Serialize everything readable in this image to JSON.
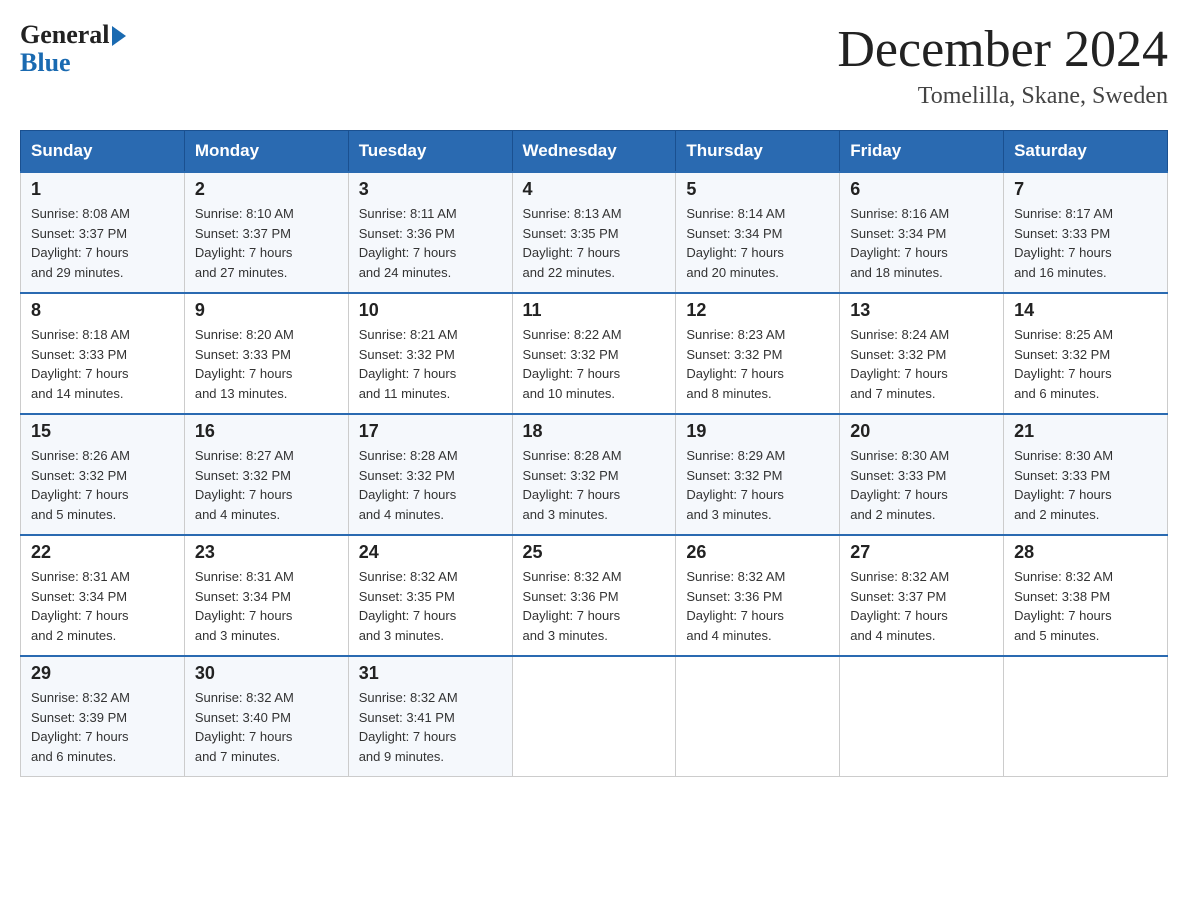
{
  "logo": {
    "general": "General",
    "blue": "Blue"
  },
  "title": "December 2024",
  "location": "Tomelilla, Skane, Sweden",
  "weekdays": [
    "Sunday",
    "Monday",
    "Tuesday",
    "Wednesday",
    "Thursday",
    "Friday",
    "Saturday"
  ],
  "weeks": [
    [
      {
        "day": "1",
        "sunrise": "8:08 AM",
        "sunset": "3:37 PM",
        "daylight": "7 hours and 29 minutes."
      },
      {
        "day": "2",
        "sunrise": "8:10 AM",
        "sunset": "3:37 PM",
        "daylight": "7 hours and 27 minutes."
      },
      {
        "day": "3",
        "sunrise": "8:11 AM",
        "sunset": "3:36 PM",
        "daylight": "7 hours and 24 minutes."
      },
      {
        "day": "4",
        "sunrise": "8:13 AM",
        "sunset": "3:35 PM",
        "daylight": "7 hours and 22 minutes."
      },
      {
        "day": "5",
        "sunrise": "8:14 AM",
        "sunset": "3:34 PM",
        "daylight": "7 hours and 20 minutes."
      },
      {
        "day": "6",
        "sunrise": "8:16 AM",
        "sunset": "3:34 PM",
        "daylight": "7 hours and 18 minutes."
      },
      {
        "day": "7",
        "sunrise": "8:17 AM",
        "sunset": "3:33 PM",
        "daylight": "7 hours and 16 minutes."
      }
    ],
    [
      {
        "day": "8",
        "sunrise": "8:18 AM",
        "sunset": "3:33 PM",
        "daylight": "7 hours and 14 minutes."
      },
      {
        "day": "9",
        "sunrise": "8:20 AM",
        "sunset": "3:33 PM",
        "daylight": "7 hours and 13 minutes."
      },
      {
        "day": "10",
        "sunrise": "8:21 AM",
        "sunset": "3:32 PM",
        "daylight": "7 hours and 11 minutes."
      },
      {
        "day": "11",
        "sunrise": "8:22 AM",
        "sunset": "3:32 PM",
        "daylight": "7 hours and 10 minutes."
      },
      {
        "day": "12",
        "sunrise": "8:23 AM",
        "sunset": "3:32 PM",
        "daylight": "7 hours and 8 minutes."
      },
      {
        "day": "13",
        "sunrise": "8:24 AM",
        "sunset": "3:32 PM",
        "daylight": "7 hours and 7 minutes."
      },
      {
        "day": "14",
        "sunrise": "8:25 AM",
        "sunset": "3:32 PM",
        "daylight": "7 hours and 6 minutes."
      }
    ],
    [
      {
        "day": "15",
        "sunrise": "8:26 AM",
        "sunset": "3:32 PM",
        "daylight": "7 hours and 5 minutes."
      },
      {
        "day": "16",
        "sunrise": "8:27 AM",
        "sunset": "3:32 PM",
        "daylight": "7 hours and 4 minutes."
      },
      {
        "day": "17",
        "sunrise": "8:28 AM",
        "sunset": "3:32 PM",
        "daylight": "7 hours and 4 minutes."
      },
      {
        "day": "18",
        "sunrise": "8:28 AM",
        "sunset": "3:32 PM",
        "daylight": "7 hours and 3 minutes."
      },
      {
        "day": "19",
        "sunrise": "8:29 AM",
        "sunset": "3:32 PM",
        "daylight": "7 hours and 3 minutes."
      },
      {
        "day": "20",
        "sunrise": "8:30 AM",
        "sunset": "3:33 PM",
        "daylight": "7 hours and 2 minutes."
      },
      {
        "day": "21",
        "sunrise": "8:30 AM",
        "sunset": "3:33 PM",
        "daylight": "7 hours and 2 minutes."
      }
    ],
    [
      {
        "day": "22",
        "sunrise": "8:31 AM",
        "sunset": "3:34 PM",
        "daylight": "7 hours and 2 minutes."
      },
      {
        "day": "23",
        "sunrise": "8:31 AM",
        "sunset": "3:34 PM",
        "daylight": "7 hours and 3 minutes."
      },
      {
        "day": "24",
        "sunrise": "8:32 AM",
        "sunset": "3:35 PM",
        "daylight": "7 hours and 3 minutes."
      },
      {
        "day": "25",
        "sunrise": "8:32 AM",
        "sunset": "3:36 PM",
        "daylight": "7 hours and 3 minutes."
      },
      {
        "day": "26",
        "sunrise": "8:32 AM",
        "sunset": "3:36 PM",
        "daylight": "7 hours and 4 minutes."
      },
      {
        "day": "27",
        "sunrise": "8:32 AM",
        "sunset": "3:37 PM",
        "daylight": "7 hours and 4 minutes."
      },
      {
        "day": "28",
        "sunrise": "8:32 AM",
        "sunset": "3:38 PM",
        "daylight": "7 hours and 5 minutes."
      }
    ],
    [
      {
        "day": "29",
        "sunrise": "8:32 AM",
        "sunset": "3:39 PM",
        "daylight": "7 hours and 6 minutes."
      },
      {
        "day": "30",
        "sunrise": "8:32 AM",
        "sunset": "3:40 PM",
        "daylight": "7 hours and 7 minutes."
      },
      {
        "day": "31",
        "sunrise": "8:32 AM",
        "sunset": "3:41 PM",
        "daylight": "7 hours and 9 minutes."
      },
      null,
      null,
      null,
      null
    ]
  ],
  "labels": {
    "sunrise": "Sunrise:",
    "sunset": "Sunset:",
    "daylight": "Daylight:"
  }
}
